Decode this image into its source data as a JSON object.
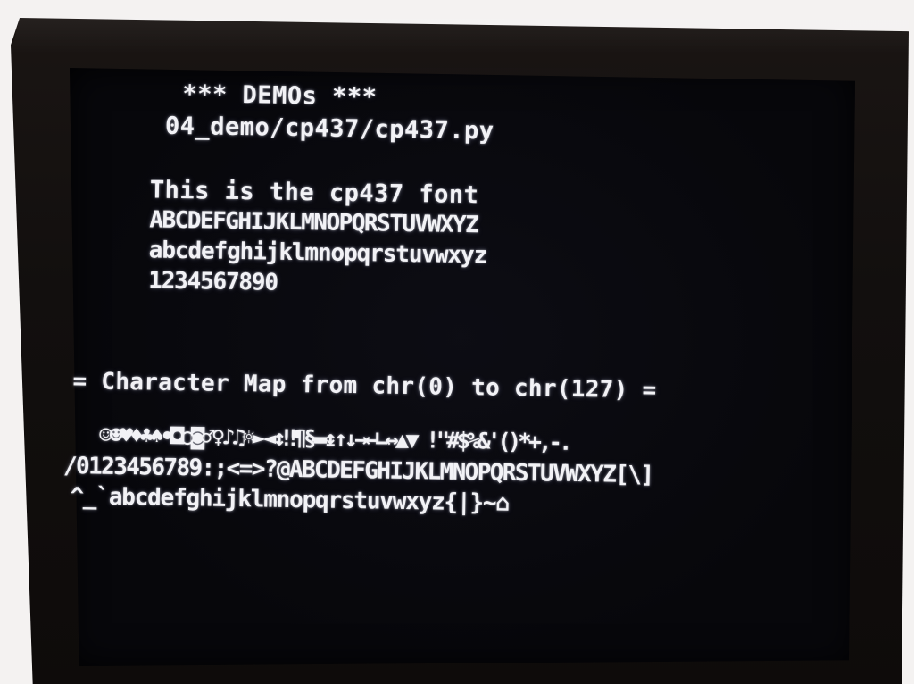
{
  "terminal": {
    "banner": "*** DEMOs ***",
    "script_path": "04_demo/cp437/cp437.py",
    "font_intro": "This is the cp437 font",
    "uppercase": "ABCDEFGHIJKLMNOPQRSTUVWXYZ",
    "lowercase": "abcdefghijklmnopqrstuvwxyz",
    "digits": "1234567890",
    "charmap_heading": "= Character Map from chr(0) to chr(127) =",
    "charmap_rows": [
      " ☺☻♥♦♣♠•◘○◙♂♀♪♫☼►◄↕‼¶§▬↨↑↓→←∟↔▲▼ !\"#$%&'()*+,-.",
      "/0123456789:;<=>?@ABCDEFGHIJKLMNOPQRSTUVWXYZ[\\]",
      "^_`abcdefghijklmnopqrstuvwxyz{|}~⌂"
    ]
  },
  "colors": {
    "screen_background": "#07070b",
    "text": "#f2f2f6",
    "bezel": "#120f0e",
    "surroundings": "#f4f2f1"
  }
}
